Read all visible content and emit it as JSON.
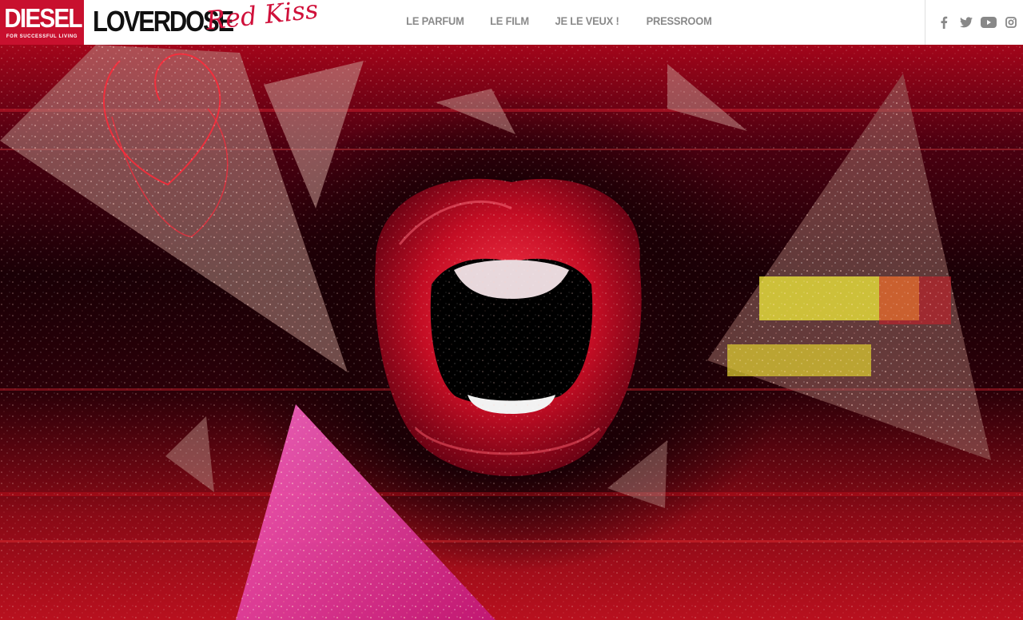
{
  "brand": {
    "name": "DIESEL",
    "tagline": "FOR SUCCESSFUL LIVING"
  },
  "product": {
    "name": "LOVERDOSE",
    "edition": "Red Kiss"
  },
  "nav": {
    "items": [
      "LE PARFUM",
      "LE FILM",
      "JE LE VEUX !",
      "PRESSROOM"
    ]
  },
  "social": {
    "icons": [
      "facebook-icon",
      "twitter-icon",
      "youtube-icon",
      "instagram-icon"
    ]
  },
  "colors": {
    "brand_red": "#c8102e",
    "nav_gray": "#8a8a8a",
    "script_red": "#d0103a",
    "icon_gray": "#888888"
  }
}
